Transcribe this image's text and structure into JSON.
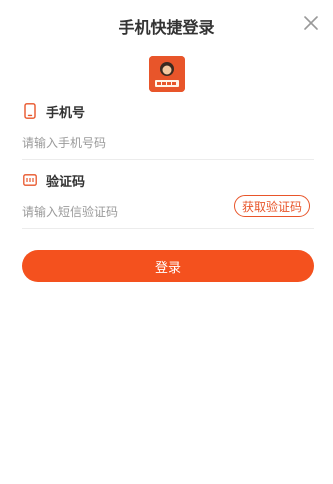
{
  "header": {
    "title": "手机快捷登录",
    "close_icon": "close-icon"
  },
  "logo": {
    "icon": "app-logo"
  },
  "phone": {
    "label": "手机号",
    "icon": "phone-icon",
    "placeholder": "请输入手机号码",
    "value": ""
  },
  "code": {
    "label": "验证码",
    "icon": "message-code-icon",
    "placeholder": "请输入短信验证码",
    "value": "",
    "get_code_label": "获取验证码"
  },
  "login": {
    "label": "登录"
  },
  "colors": {
    "accent": "#f4511e",
    "accent_border": "#e8552a",
    "placeholder": "#9a9a9a",
    "divider": "#ececec"
  }
}
